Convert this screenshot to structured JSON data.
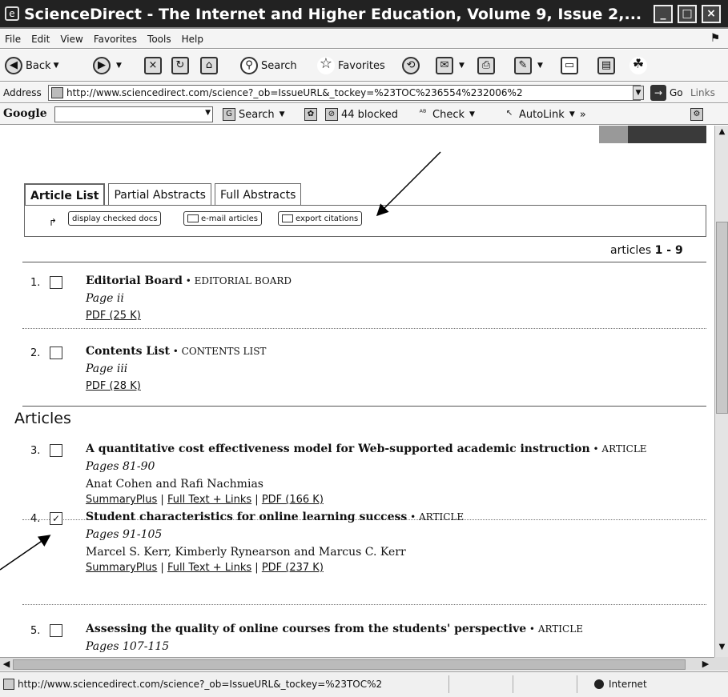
{
  "window": {
    "title": "ScienceDirect - The Internet and Higher Education, Volume 9, Issue 2,...",
    "icon": "ie-window-icon",
    "buttons": [
      "minimize",
      "maximize",
      "close"
    ]
  },
  "menubar": {
    "items": [
      "File",
      "Edit",
      "View",
      "Favorites",
      "Tools",
      "Help"
    ]
  },
  "toolbar": {
    "back_label": "Back",
    "search_label": "Search",
    "favorites_label": "Favorites"
  },
  "address": {
    "label": "Address",
    "url": "http://www.sciencedirect.com/science?_ob=IssueURL&_tockey=%23TOC%236554%232006%2",
    "go_label": "Go",
    "links_label": "Links"
  },
  "googlebar": {
    "logo": "Google",
    "search_label": "Search",
    "blocked_label": "44 blocked",
    "check_label": "Check",
    "autolink_label": "AutoLink"
  },
  "tabs": {
    "items": [
      "Article List",
      "Partial Abstracts",
      "Full Abstracts"
    ],
    "active": "Article List"
  },
  "actions": {
    "display_label": "display checked docs",
    "email_label": "e-mail articles",
    "export_label": "export citations"
  },
  "results": {
    "count_prefix": "articles ",
    "count_range": "1 - 9"
  },
  "section": {
    "articles_heading": "Articles"
  },
  "entries": [
    {
      "num": "1.",
      "checked": false,
      "title": "Editorial Board",
      "type": " • EDITORIAL BOARD",
      "pages": "Page ii",
      "authors": "",
      "pdf": "PDF (25 K)"
    },
    {
      "num": "2.",
      "checked": false,
      "title": "Contents List",
      "type": " • CONTENTS LIST",
      "pages": "Page iii",
      "authors": "",
      "pdf": "PDF (28 K)"
    },
    {
      "num": "3.",
      "checked": false,
      "title": "A quantitative cost effectiveness model for Web-supported academic instruction",
      "type": " • ARTICLE",
      "pages": "Pages 81-90",
      "authors": "Anat Cohen and Rafi Nachmias",
      "summary": "SummaryPlus",
      "fulltext": "Full Text + Links",
      "pdf": "PDF (166 K)"
    },
    {
      "num": "4.",
      "checked": true,
      "title": "Student characteristics for online learning success",
      "type": " • ARTICLE",
      "pages": "Pages 91-105",
      "authors": "Marcel S. Kerr, Kimberly Rynearson and Marcus C. Kerr",
      "summary": "SummaryPlus",
      "fulltext": "Full Text + Links",
      "pdf": "PDF (237 K)"
    },
    {
      "num": "5.",
      "checked": false,
      "title": "Assessing the quality of online courses from the students' perspective",
      "type": " • ARTICLE",
      "pages": "Pages 107-115"
    }
  ],
  "link_separator": " | ",
  "status": {
    "url": "http://www.sciencedirect.com/science?_ob=IssueURL&_tockey=%23TOC%2",
    "zone": "Internet"
  }
}
